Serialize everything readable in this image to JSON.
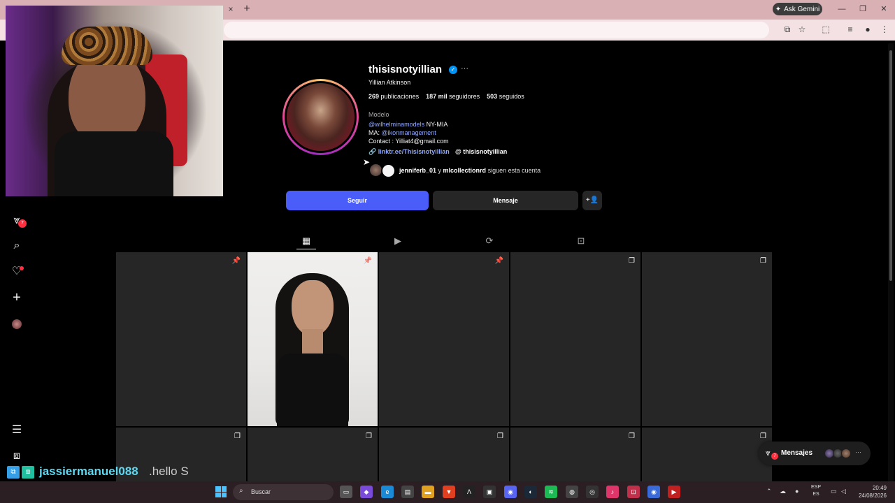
{
  "browser": {
    "tab_close": "×",
    "new_tab": "+",
    "ask_gemini": "Ask Gemini",
    "window": {
      "minimize": "—",
      "maximize": "❐",
      "close": "✕"
    }
  },
  "nav": {
    "messages_badge": "7"
  },
  "profile": {
    "username": "thisisnotyillian",
    "verified_glyph": "✓",
    "more": "···",
    "full_name": "Yillian Atkinson",
    "stats": {
      "posts_count": "269",
      "posts_label": "publicaciones",
      "followers_count": "187 mil",
      "followers_label": "seguidores",
      "following_count": "503",
      "following_label": "seguidos"
    },
    "category": "Modelo",
    "bio": {
      "line1_link": "@wilhelminamodels",
      "line1_rest": " NY-MIA",
      "line2_prefix": "MA: ",
      "line2_link": "@ikonmanagement",
      "line3": "Contact : Yilliat4@gmail.com"
    },
    "link": "🔗 linktr.ee/Thisisnotyillian",
    "threads": "@ thisisnotyillian",
    "followed_by": {
      "user1": "jenniferb_01",
      "connector": " y ",
      "user2": "mlcollectionrd",
      "suffix": " siguen esta cuenta"
    }
  },
  "buttons": {
    "follow": "Seguir",
    "message": "Mensaje",
    "suggest_icon": "+👤"
  },
  "messages_pill": {
    "label": "Mensajes",
    "badge": "7"
  },
  "chat_overlay": {
    "user": "jassiermanuel088",
    "message": ".hello S"
  },
  "taskbar": {
    "search_placeholder": "Buscar",
    "lang_top": "ESP",
    "lang_bottom": "ES",
    "time": "20:49",
    "date": "24/08/2026"
  },
  "colors": {
    "follow_button": "#4a5df9",
    "verified": "#0095f6",
    "link": "#8fa7ff",
    "badge": "#ff3040"
  }
}
